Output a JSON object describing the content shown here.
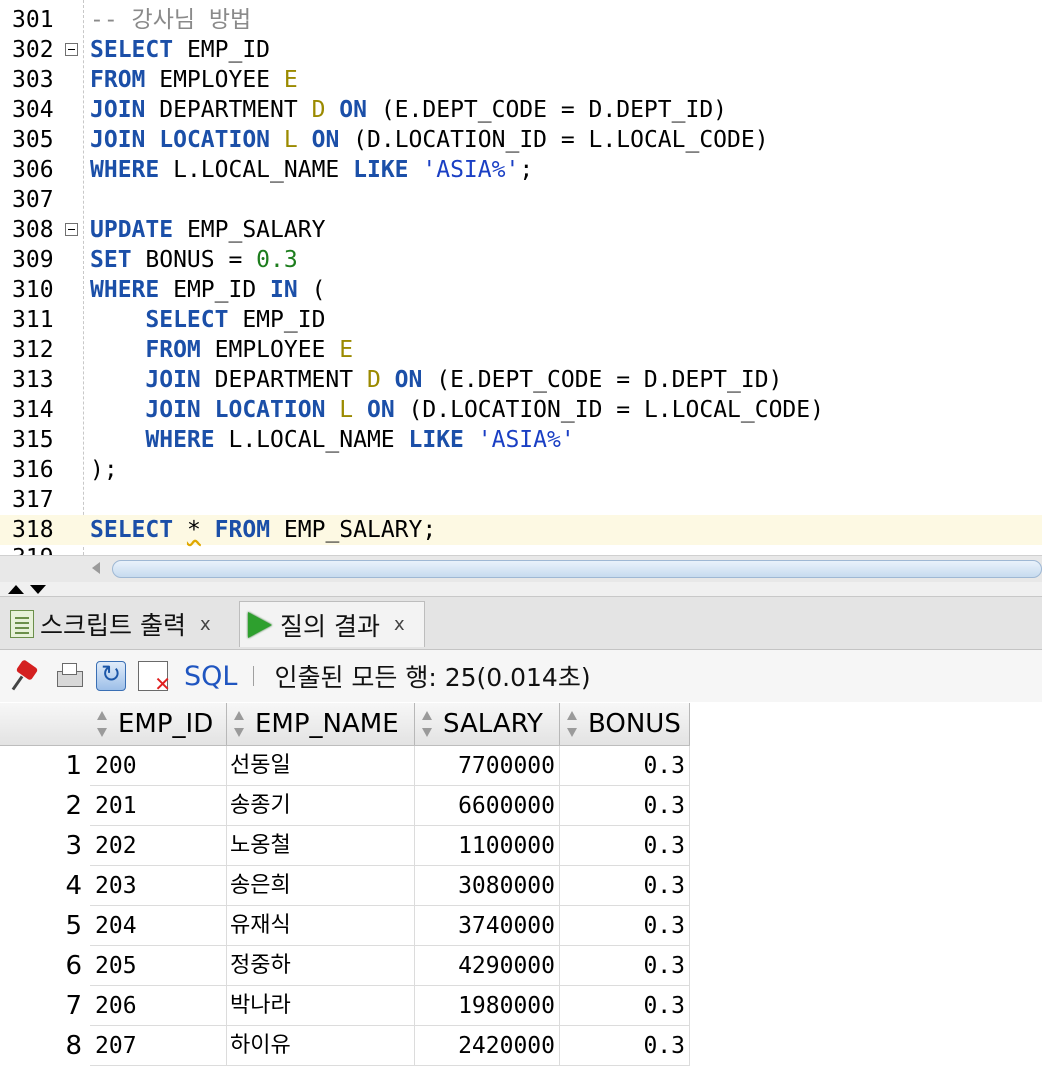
{
  "editor": {
    "lines": [
      {
        "n": "301",
        "fold": false,
        "current": false,
        "tokens": [
          {
            "t": "-- 강사님 방법",
            "c": "cm"
          }
        ]
      },
      {
        "n": "302",
        "fold": true,
        "current": false,
        "tokens": [
          {
            "t": "SELECT",
            "c": "kw"
          },
          {
            "t": " EMP_ID",
            "c": "id"
          }
        ]
      },
      {
        "n": "303",
        "fold": false,
        "current": false,
        "tokens": [
          {
            "t": "FROM",
            "c": "kw"
          },
          {
            "t": " EMPLOYEE ",
            "c": "id"
          },
          {
            "t": "E",
            "c": "al"
          }
        ]
      },
      {
        "n": "304",
        "fold": false,
        "current": false,
        "tokens": [
          {
            "t": "JOIN",
            "c": "kw"
          },
          {
            "t": " DEPARTMENT ",
            "c": "id"
          },
          {
            "t": "D",
            "c": "al"
          },
          {
            "t": " ",
            "c": "id"
          },
          {
            "t": "ON",
            "c": "kw"
          },
          {
            "t": " (E.DEPT_CODE = D.DEPT_ID)",
            "c": "id"
          }
        ]
      },
      {
        "n": "305",
        "fold": false,
        "current": false,
        "tokens": [
          {
            "t": "JOIN",
            "c": "kw"
          },
          {
            "t": " ",
            "c": "id"
          },
          {
            "t": "LOCATION",
            "c": "kw"
          },
          {
            "t": " ",
            "c": "id"
          },
          {
            "t": "L",
            "c": "al"
          },
          {
            "t": " ",
            "c": "id"
          },
          {
            "t": "ON",
            "c": "kw"
          },
          {
            "t": " (D.LOCATION_ID = L.LOCAL_CODE)",
            "c": "id"
          }
        ]
      },
      {
        "n": "306",
        "fold": false,
        "current": false,
        "tokens": [
          {
            "t": "WHERE",
            "c": "kw"
          },
          {
            "t": " L.LOCAL_NAME ",
            "c": "id"
          },
          {
            "t": "LIKE",
            "c": "kw"
          },
          {
            "t": " ",
            "c": "id"
          },
          {
            "t": "'ASIA%'",
            "c": "str"
          },
          {
            "t": ";",
            "c": "id"
          }
        ]
      },
      {
        "n": "307",
        "fold": false,
        "current": false,
        "tokens": []
      },
      {
        "n": "308",
        "fold": true,
        "current": false,
        "tokens": [
          {
            "t": "UPDATE",
            "c": "kw"
          },
          {
            "t": " EMP_SALARY",
            "c": "id"
          }
        ]
      },
      {
        "n": "309",
        "fold": false,
        "current": false,
        "tokens": [
          {
            "t": "SET",
            "c": "kw"
          },
          {
            "t": " BONUS = ",
            "c": "id"
          },
          {
            "t": "0.3",
            "c": "num"
          }
        ]
      },
      {
        "n": "310",
        "fold": false,
        "current": false,
        "tokens": [
          {
            "t": "WHERE",
            "c": "kw"
          },
          {
            "t": " EMP_ID ",
            "c": "id"
          },
          {
            "t": "IN",
            "c": "kw"
          },
          {
            "t": " (",
            "c": "id"
          }
        ]
      },
      {
        "n": "311",
        "fold": false,
        "current": false,
        "tokens": [
          {
            "t": "    ",
            "c": "id"
          },
          {
            "t": "SELECT",
            "c": "kw"
          },
          {
            "t": " EMP_ID",
            "c": "id"
          }
        ]
      },
      {
        "n": "312",
        "fold": false,
        "current": false,
        "tokens": [
          {
            "t": "    ",
            "c": "id"
          },
          {
            "t": "FROM",
            "c": "kw"
          },
          {
            "t": " EMPLOYEE ",
            "c": "id"
          },
          {
            "t": "E",
            "c": "al"
          }
        ]
      },
      {
        "n": "313",
        "fold": false,
        "current": false,
        "tokens": [
          {
            "t": "    ",
            "c": "id"
          },
          {
            "t": "JOIN",
            "c": "kw"
          },
          {
            "t": " DEPARTMENT ",
            "c": "id"
          },
          {
            "t": "D",
            "c": "al"
          },
          {
            "t": " ",
            "c": "id"
          },
          {
            "t": "ON",
            "c": "kw"
          },
          {
            "t": " (E.DEPT_CODE = D.DEPT_ID)",
            "c": "id"
          }
        ]
      },
      {
        "n": "314",
        "fold": false,
        "current": false,
        "tokens": [
          {
            "t": "    ",
            "c": "id"
          },
          {
            "t": "JOIN",
            "c": "kw"
          },
          {
            "t": " ",
            "c": "id"
          },
          {
            "t": "LOCATION",
            "c": "kw"
          },
          {
            "t": " ",
            "c": "id"
          },
          {
            "t": "L",
            "c": "al"
          },
          {
            "t": " ",
            "c": "id"
          },
          {
            "t": "ON",
            "c": "kw"
          },
          {
            "t": " (D.LOCATION_ID = L.LOCAL_CODE)",
            "c": "id"
          }
        ]
      },
      {
        "n": "315",
        "fold": false,
        "current": false,
        "tokens": [
          {
            "t": "    ",
            "c": "id"
          },
          {
            "t": "WHERE",
            "c": "kw"
          },
          {
            "t": " L.LOCAL_NAME ",
            "c": "id"
          },
          {
            "t": "LIKE",
            "c": "kw"
          },
          {
            "t": " ",
            "c": "id"
          },
          {
            "t": "'ASIA%'",
            "c": "str"
          }
        ]
      },
      {
        "n": "316",
        "fold": false,
        "current": false,
        "tokens": [
          {
            "t": ");",
            "c": "id"
          }
        ]
      },
      {
        "n": "317",
        "fold": false,
        "current": false,
        "tokens": []
      },
      {
        "n": "318",
        "fold": false,
        "current": true,
        "tokens": [
          {
            "t": "SELECT",
            "c": "kw"
          },
          {
            "t": " ",
            "c": "id"
          },
          {
            "t": "*",
            "c": "squig"
          },
          {
            "t": " ",
            "c": "id"
          },
          {
            "t": "FROM",
            "c": "kw"
          },
          {
            "t": " EMP_SALARY;",
            "c": "id"
          }
        ]
      }
    ]
  },
  "tabs": {
    "script_output": "스크립트 출력",
    "query_result": "질의 결과",
    "close_glyph": "x"
  },
  "toolbar": {
    "sql_label": "SQL",
    "status": "인출된 모든 행: 25(0.014초)"
  },
  "grid": {
    "columns": [
      "EMP_ID",
      "EMP_NAME",
      "SALARY",
      "BONUS"
    ],
    "rows": [
      [
        "1",
        "200",
        "선동일",
        "7700000",
        "0.3"
      ],
      [
        "2",
        "201",
        "송종기",
        "6600000",
        "0.3"
      ],
      [
        "3",
        "202",
        "노옹철",
        "1100000",
        "0.3"
      ],
      [
        "4",
        "203",
        "송은희",
        "3080000",
        "0.3"
      ],
      [
        "5",
        "204",
        "유재식",
        "3740000",
        "0.3"
      ],
      [
        "6",
        "205",
        "정중하",
        "4290000",
        "0.3"
      ],
      [
        "7",
        "206",
        "박나라",
        "1980000",
        "0.3"
      ],
      [
        "8",
        "207",
        "하이유",
        "2420000",
        "0.3"
      ]
    ]
  }
}
